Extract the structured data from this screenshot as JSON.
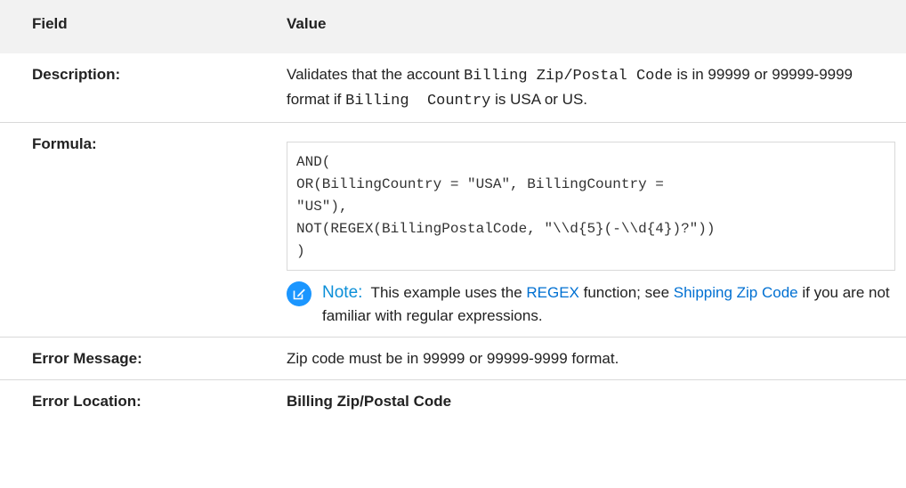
{
  "header": {
    "field": "Field",
    "value": "Value"
  },
  "rows": {
    "description": {
      "label": "Description:",
      "t1": "Validates that the account ",
      "code1": "Billing Zip/Postal Code",
      "t2": " is in 99999 or 99999-9999 format if ",
      "code2": "Billing  Country",
      "t3": " is USA or US."
    },
    "formula": {
      "label": "Formula:",
      "code": [
        "AND(",
        "OR(BillingCountry = \"USA\", BillingCountry =",
        "\"US\"),",
        "NOT(REGEX(BillingPostalCode, \"\\\\d{5}(-\\\\d{4})?\"))",
        ")"
      ],
      "note": {
        "label": "Note:",
        "t1": "  This example uses the ",
        "link1": "REGEX",
        "t2": " function; see ",
        "link2": "Shipping Zip Code",
        "t3": " if you are not familiar with regular expressions."
      }
    },
    "error_message": {
      "label": "Error Message:",
      "value": "Zip code must be in 99999 or 99999-9999 format."
    },
    "error_location": {
      "label": "Error Location:",
      "value": "Billing Zip/Postal Code"
    }
  },
  "icons": {
    "note": "edit-note-icon"
  },
  "colors": {
    "accent": "#1b96ff",
    "link": "#0070d2",
    "header_bg": "#f2f2f2"
  }
}
